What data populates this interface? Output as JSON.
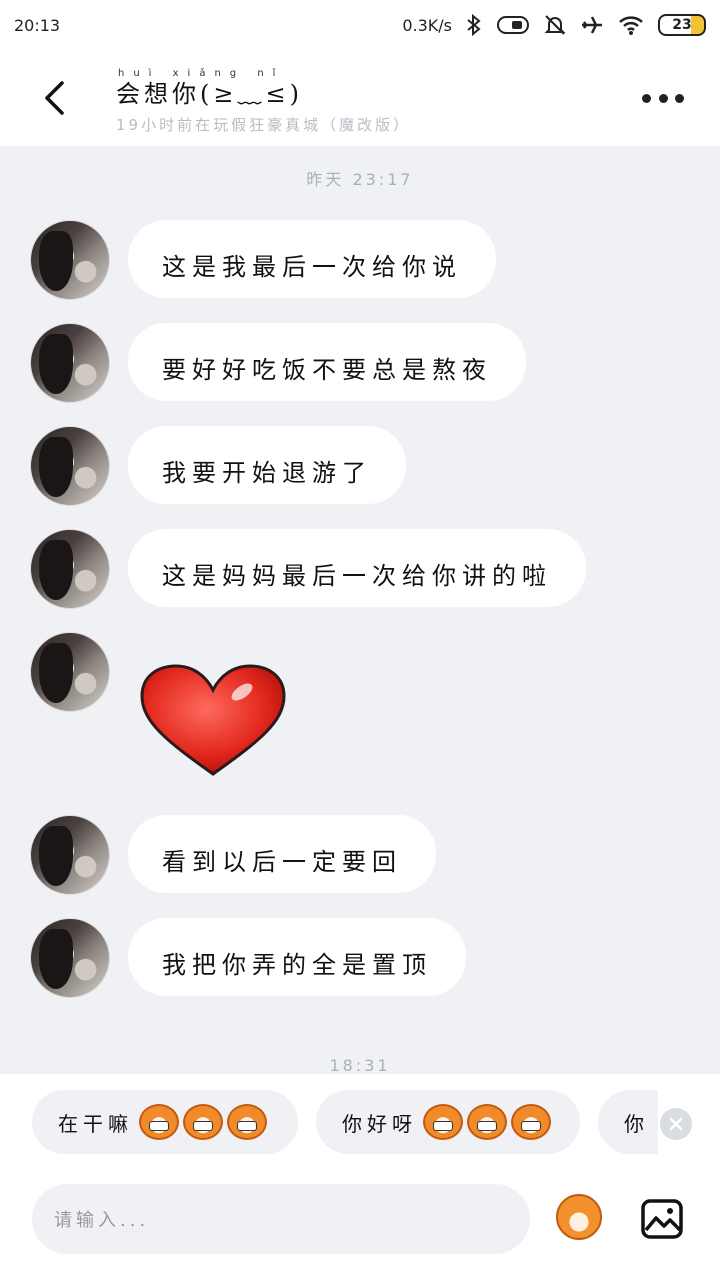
{
  "status_bar": {
    "time": "20:13",
    "net_speed": "0.3K/s",
    "battery": "23",
    "icons": [
      "bluetooth-icon",
      "vibrate-icon",
      "mute-icon",
      "airplane-icon",
      "wifi-icon"
    ]
  },
  "header": {
    "title": "会想你(≥﹏≤)",
    "title_pinyin": "huì xiǎng nǐ",
    "subtitle": "19小时前在玩假狂豪真城（魔改版）",
    "back_icon": "chevron-left-icon",
    "more_icon": "more-dots-icon"
  },
  "chat": {
    "timestamp_top": "昨天 23:17",
    "messages": [
      {
        "type": "text",
        "text": "这是我最后一次给你说"
      },
      {
        "type": "text",
        "text": "要好好吃饭不要总是熬夜"
      },
      {
        "type": "text",
        "text": "我要开始退游了"
      },
      {
        "type": "text",
        "text": "这是妈妈最后一次给你讲的啦"
      },
      {
        "type": "sticker",
        "icon": "red-heart-icon"
      },
      {
        "type": "text",
        "text": "看到以后一定要回"
      },
      {
        "type": "text",
        "text": "我把你弄的全是置顶"
      }
    ],
    "timestamp_bottom": "18:31"
  },
  "quick_replies": {
    "items": [
      {
        "text": "在干嘛",
        "emoji_icon": "grin-monkey-icon"
      },
      {
        "text": "你好呀",
        "emoji_icon": "smile-monkey-icon"
      },
      {
        "text": "你"
      }
    ],
    "close_icon": "close-icon"
  },
  "input": {
    "placeholder": "请输入...",
    "sticker_icon": "monkey-sticker-icon",
    "image_icon": "image-icon"
  },
  "colors": {
    "background": "#eff1f4",
    "bubble": "#ffffff",
    "heart": "#e8342a",
    "accent_orange": "#f08a2a"
  }
}
